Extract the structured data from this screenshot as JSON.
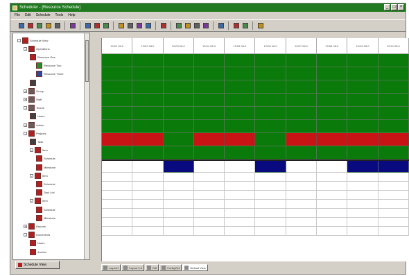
{
  "window": {
    "title": "Scheduler - [Resource Schedule]"
  },
  "menu": [
    "File",
    "Edit",
    "Schedule",
    "Tools",
    "Help"
  ],
  "toolbar": {
    "groups": [
      [
        "first-icon",
        "back-icon",
        "print-icon",
        "filter-icon",
        "help-icon"
      ],
      [
        "cut-icon"
      ],
      [
        "grid-icon",
        "grid-icon",
        "grid-icon"
      ],
      [
        "calendar-icon",
        "save-icon",
        "up-icon",
        "undo-icon"
      ],
      [
        "open-icon"
      ],
      [
        "copy-icon",
        "paste-icon",
        "redo-icon",
        "refresh-icon"
      ],
      [
        "chart-icon"
      ],
      [
        "layout-icon",
        "layout-icon"
      ],
      [
        "tools-icon"
      ]
    ]
  },
  "tree": {
    "tab_label": "Schedule View",
    "nodes": [
      {
        "label": "Schedule View",
        "level": 0,
        "icon": "red",
        "expander": "-"
      },
      {
        "label": "Operations",
        "level": 1,
        "icon": "red",
        "expander": "-"
      },
      {
        "label": "Resource One",
        "level": 2,
        "icon": "red",
        "expander": ""
      },
      {
        "label": "Resource Two",
        "level": 3,
        "icon": "green",
        "expander": ""
      },
      {
        "label": "Resource Three",
        "level": 3,
        "icon": "blue",
        "expander": ""
      },
      {
        "label": "",
        "level": 2,
        "icon": "dark",
        "expander": ""
      },
      {
        "label": "Group",
        "level": 1,
        "icon": "people",
        "expander": "+"
      },
      {
        "label": "Staff",
        "level": 1,
        "icon": "people",
        "expander": "+"
      },
      {
        "label": "Teams",
        "level": 1,
        "icon": "people",
        "expander": "-"
      },
      {
        "label": "Users",
        "level": 2,
        "icon": "dark",
        "expander": ""
      },
      {
        "label": "Admin",
        "level": 1,
        "icon": "people",
        "expander": "+"
      },
      {
        "label": "Projects",
        "level": 1,
        "icon": "red",
        "expander": "-"
      },
      {
        "label": "Task",
        "level": 2,
        "icon": "dark",
        "expander": ""
      },
      {
        "label": "Item",
        "level": 2,
        "icon": "red",
        "expander": "-"
      },
      {
        "label": "Schedule",
        "level": 3,
        "icon": "red",
        "expander": ""
      },
      {
        "label": "Milestone",
        "level": 3,
        "icon": "red",
        "expander": ""
      },
      {
        "label": "Item",
        "level": 2,
        "icon": "red",
        "expander": "-"
      },
      {
        "label": "Schedule",
        "level": 3,
        "icon": "red",
        "expander": ""
      },
      {
        "label": "Task List",
        "level": 3,
        "icon": "red",
        "expander": ""
      },
      {
        "label": "Item",
        "level": 2,
        "icon": "red",
        "expander": "-"
      },
      {
        "label": "Schedule",
        "level": 3,
        "icon": "red",
        "expander": ""
      },
      {
        "label": "Milestone",
        "level": 3,
        "icon": "red",
        "expander": ""
      },
      {
        "label": "Reports",
        "level": 1,
        "icon": "red",
        "expander": "+"
      },
      {
        "label": "Documents",
        "level": 1,
        "icon": "red",
        "expander": "-"
      },
      {
        "label": "Notes",
        "level": 2,
        "icon": "red",
        "expander": ""
      },
      {
        "label": "Archive",
        "level": 2,
        "icon": "red",
        "expander": ""
      }
    ]
  },
  "grid": {
    "columns": [
      "12/01 08:0",
      "12/02 08:0",
      "12/03 08:0",
      "12/04 08:0",
      "12/05 08:0",
      "12/06 08:0",
      "12/07 08:0",
      "12/08 08:0",
      "12/09 08:0",
      "12/10 08:0"
    ],
    "rows": [
      [
        "green",
        "green",
        "green",
        "green",
        "green",
        "green",
        "green",
        "green",
        "green",
        "green"
      ],
      [
        "green",
        "green",
        "green",
        "green",
        "green",
        "green",
        "green",
        "green",
        "green",
        "green"
      ],
      [
        "green",
        "green",
        "green",
        "green",
        "green",
        "green",
        "green",
        "green",
        "green",
        "green"
      ],
      [
        "green",
        "green",
        "green",
        "green",
        "green",
        "green",
        "green",
        "green",
        "green",
        "green"
      ],
      [
        "green",
        "green",
        "green",
        "green",
        "green",
        "green",
        "green",
        "green",
        "green",
        "green"
      ],
      [
        "green",
        "green",
        "green",
        "green",
        "green",
        "green",
        "green",
        "green",
        "green",
        "green"
      ],
      [
        "red",
        "red",
        "green",
        "red",
        "red",
        "green",
        "red",
        "red",
        "red",
        "red"
      ],
      [
        "green",
        "green",
        "green",
        "green",
        "green",
        "green",
        "green",
        "green",
        "green",
        "green"
      ],
      [
        "white",
        "white",
        "blue",
        "white",
        "white",
        "blue",
        "white",
        "white",
        "blue",
        "blue"
      ],
      [
        "white",
        "white",
        "white",
        "white",
        "white",
        "white",
        "white",
        "white",
        "white",
        "white"
      ],
      [
        "white",
        "white",
        "white",
        "white",
        "white",
        "white",
        "white",
        "white",
        "white",
        "white"
      ],
      [
        "white",
        "white",
        "white",
        "white",
        "white",
        "white",
        "white",
        "white",
        "white",
        "white"
      ],
      [
        "white",
        "white",
        "white",
        "white",
        "white",
        "white",
        "white",
        "white",
        "white",
        "white"
      ],
      [
        "white",
        "white",
        "white",
        "white",
        "white",
        "white",
        "white",
        "white",
        "white",
        "white"
      ],
      [
        "white",
        "white",
        "white",
        "white",
        "white",
        "white",
        "white",
        "white",
        "white",
        "white"
      ],
      [
        "white",
        "white",
        "white",
        "white",
        "white",
        "white",
        "white",
        "white",
        "white",
        "white"
      ]
    ]
  },
  "bottom_tabs": [
    "Layout1",
    "Layout 2-6",
    "Diff",
    "Config204",
    "Default View"
  ],
  "colors": {
    "green": "#0a7a0a",
    "red": "#c81414",
    "blue": "#0a0a80",
    "title": "#1f7a1f"
  }
}
